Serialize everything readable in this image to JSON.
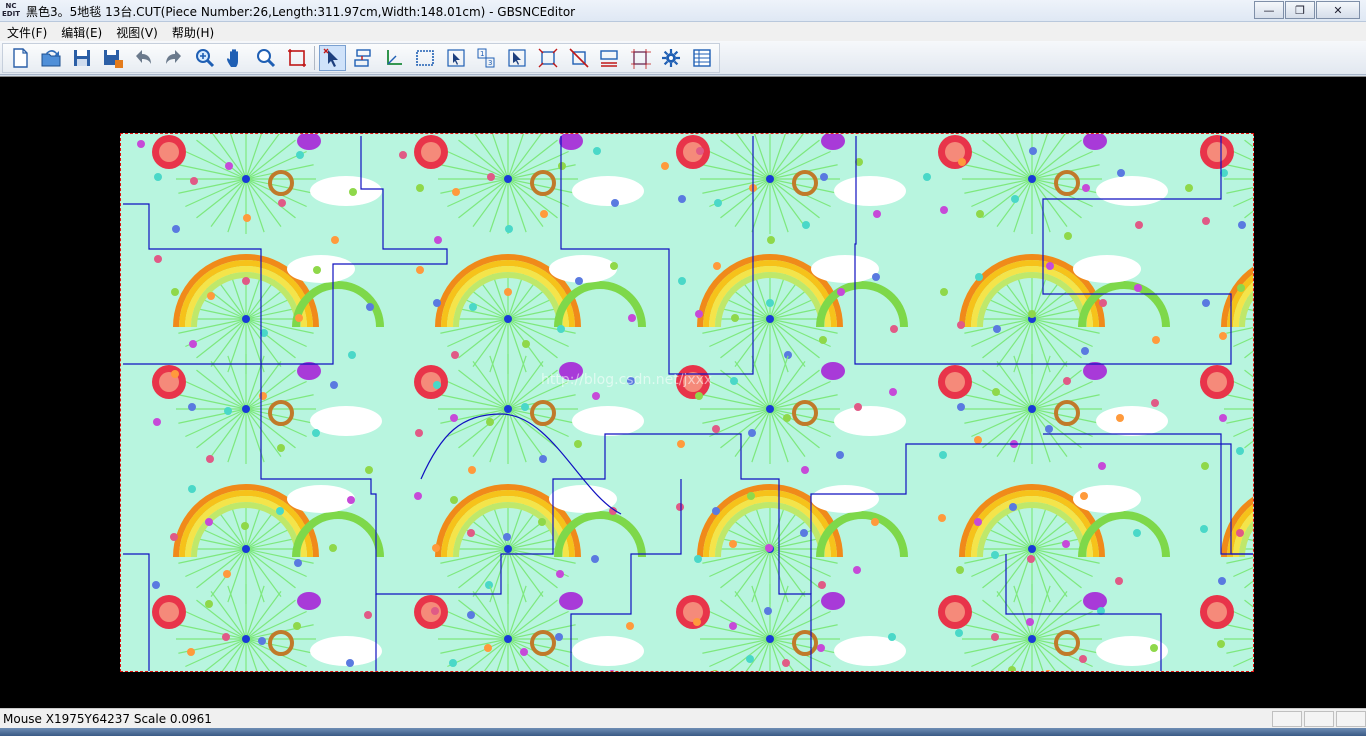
{
  "window": {
    "icon_text": "NC EDIT",
    "title": "黑色3。5地毯  13台.CUT(Piece Number:26,Length:311.97cm,Width:148.01cm) - GBSNCEditor",
    "minimize_glyph": "—",
    "restore_glyph": "❐",
    "close_glyph": "✕"
  },
  "menu": {
    "items": [
      {
        "label": "文件(F)"
      },
      {
        "label": "编辑(E)"
      },
      {
        "label": "视图(V)"
      },
      {
        "label": "帮助(H)"
      }
    ]
  },
  "toolbar": {
    "buttons": [
      {
        "icon": "new-file-icon"
      },
      {
        "icon": "open-file-icon"
      },
      {
        "icon": "save-icon"
      },
      {
        "icon": "save-as-icon"
      },
      {
        "icon": "undo-icon"
      },
      {
        "icon": "redo-icon"
      },
      {
        "icon": "zoom-in-icon"
      },
      {
        "icon": "pan-hand-icon"
      },
      {
        "icon": "zoom-window-icon"
      },
      {
        "icon": "fit-view-icon"
      },
      {
        "icon": "select-arrow-icon",
        "active": true
      },
      {
        "icon": "arrange-pieces-icon"
      },
      {
        "icon": "origin-icon"
      },
      {
        "icon": "rectangle-select-icon"
      },
      {
        "icon": "piece-select-icon"
      },
      {
        "icon": "numbering-icon"
      },
      {
        "icon": "move-piece-icon"
      },
      {
        "icon": "scale-piece-icon"
      },
      {
        "icon": "no-scale-icon"
      },
      {
        "icon": "measure-icon"
      },
      {
        "icon": "bounds-icon"
      },
      {
        "icon": "settings-gear-icon"
      },
      {
        "icon": "properties-table-icon"
      }
    ]
  },
  "canvas": {
    "background": "#000000",
    "sheet_color": "#b8f5df",
    "sheet_border": "#e01010",
    "cut_line_color": "#1010c0",
    "watermark": "http://blog.csdn.net/jxxx"
  },
  "status": {
    "text": "Mouse X1975Y64237 Scale 0.0961"
  }
}
